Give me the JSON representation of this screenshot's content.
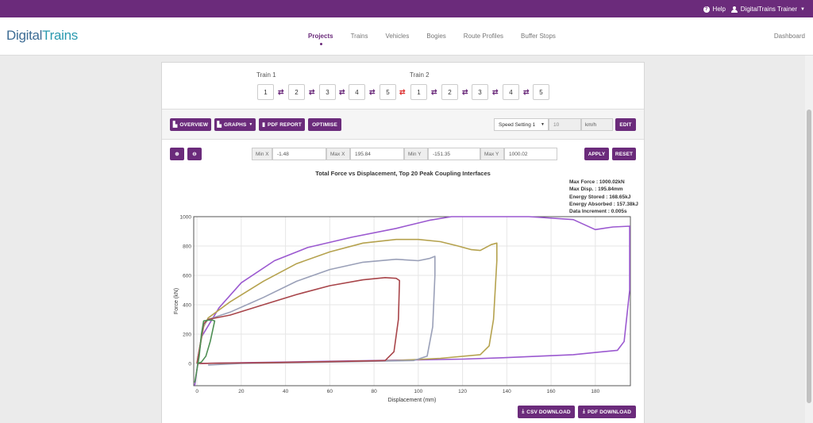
{
  "topbar": {
    "help": "Help",
    "user": "DigitalTrains Trainer"
  },
  "logo": {
    "part1": "Digital",
    "part2": "Trains"
  },
  "nav": {
    "items": [
      "Projects",
      "Trains",
      "Vehicles",
      "Bogies",
      "Route Profiles",
      "Buffer Stops"
    ],
    "active": "Projects",
    "dashboard": "Dashboard"
  },
  "trains": {
    "train1_label": "Train 1",
    "train2_label": "Train 2",
    "train1": [
      "1",
      "2",
      "3",
      "4",
      "5"
    ],
    "train2": [
      "1",
      "2",
      "3",
      "4",
      "5"
    ],
    "coupling_icon": "swap-arrows-icon"
  },
  "toolbar": {
    "overview": "OVERVIEW",
    "graphs": "GRAPHS",
    "pdf_report": "PDF REPORT",
    "optimise": "OPTIMISE",
    "speed_setting": "Speed Setting 1",
    "speed_value": "10",
    "speed_unit": "km/h",
    "edit": "EDIT"
  },
  "limits": {
    "min_x_label": "Min X",
    "min_x": "-1.48",
    "max_x_label": "Max X",
    "max_x": "195.84",
    "min_y_label": "Min Y",
    "min_y": "-151.35",
    "max_y_label": "Max Y",
    "max_y": "1000.02",
    "apply": "APPLY",
    "reset": "RESET"
  },
  "stats": {
    "max_force": "Max Force : 1000.02kN",
    "max_disp": "Max Disp. : 195.84mm",
    "energy_stored": "Energy Stored : 168.65kJ",
    "energy_absorbed": "Energy Absorbed : 157.38kJ",
    "data_increment": "Data Increment : 0.005s"
  },
  "downloads": {
    "csv": "CSV DOWNLOAD",
    "pdf": "PDF DOWNLOAD"
  },
  "colors": {
    "accent": "#6b2b7b"
  },
  "chart_data": {
    "type": "line",
    "title": "Total Force vs Displacement, Top 20 Peak Coupling Interfaces",
    "xlabel": "Displacement (mm)",
    "ylabel": "Force (kN)",
    "xlim": [
      -1.48,
      195.84
    ],
    "ylim": [
      -151.35,
      1000.02
    ],
    "xticks": [
      0,
      20,
      40,
      60,
      80,
      100,
      120,
      140,
      160,
      180
    ],
    "yticks": [
      0,
      200,
      400,
      600,
      800,
      1000
    ],
    "grid": true,
    "series": [
      {
        "color": "#9b59d0",
        "points": [
          [
            -1,
            -150
          ],
          [
            2,
            180
          ],
          [
            10,
            380
          ],
          [
            20,
            550
          ],
          [
            35,
            700
          ],
          [
            50,
            790
          ],
          [
            70,
            860
          ],
          [
            90,
            920
          ],
          [
            105,
            975
          ],
          [
            115,
            1000
          ],
          [
            150,
            1000
          ],
          [
            170,
            980
          ],
          [
            180,
            912
          ],
          [
            188,
            930
          ],
          [
            195.5,
            935
          ],
          [
            195.5,
            500
          ],
          [
            193,
            150
          ],
          [
            190,
            90
          ],
          [
            170,
            60
          ],
          [
            140,
            40
          ],
          [
            120,
            30
          ],
          [
            100,
            25
          ],
          [
            80,
            20
          ],
          [
            60,
            15
          ],
          [
            40,
            10
          ],
          [
            20,
            5
          ],
          [
            0,
            0
          ]
        ]
      },
      {
        "color": "#b5a24e",
        "points": [
          [
            0,
            0
          ],
          [
            3,
            250
          ],
          [
            5,
            310
          ],
          [
            15,
            420
          ],
          [
            30,
            560
          ],
          [
            45,
            680
          ],
          [
            60,
            760
          ],
          [
            75,
            820
          ],
          [
            90,
            845
          ],
          [
            100,
            845
          ],
          [
            110,
            830
          ],
          [
            118,
            800
          ],
          [
            124,
            775
          ],
          [
            128,
            770
          ],
          [
            133,
            810
          ],
          [
            135.5,
            820
          ],
          [
            135.5,
            700
          ],
          [
            134,
            300
          ],
          [
            132,
            120
          ],
          [
            128,
            60
          ],
          [
            110,
            35
          ],
          [
            90,
            20
          ],
          [
            70,
            15
          ],
          [
            50,
            10
          ],
          [
            30,
            5
          ],
          [
            10,
            0
          ]
        ]
      },
      {
        "color": "#9aa0b8",
        "points": [
          [
            0,
            0
          ],
          [
            3,
            260
          ],
          [
            5,
            300
          ],
          [
            15,
            350
          ],
          [
            30,
            450
          ],
          [
            45,
            560
          ],
          [
            60,
            640
          ],
          [
            75,
            690
          ],
          [
            90,
            710
          ],
          [
            100,
            700
          ],
          [
            105,
            715
          ],
          [
            107.5,
            730
          ],
          [
            107.5,
            600
          ],
          [
            106.5,
            250
          ],
          [
            104,
            50
          ],
          [
            98,
            20
          ],
          [
            80,
            15
          ],
          [
            60,
            10
          ],
          [
            40,
            5
          ],
          [
            20,
            0
          ],
          [
            5,
            -10
          ]
        ]
      },
      {
        "color": "#a8454a",
        "points": [
          [
            0,
            0
          ],
          [
            3,
            270
          ],
          [
            5,
            300
          ],
          [
            15,
            330
          ],
          [
            30,
            400
          ],
          [
            45,
            470
          ],
          [
            60,
            530
          ],
          [
            75,
            570
          ],
          [
            85,
            585
          ],
          [
            90,
            580
          ],
          [
            91.5,
            565
          ],
          [
            91,
            300
          ],
          [
            89,
            80
          ],
          [
            85,
            20
          ],
          [
            70,
            15
          ],
          [
            50,
            10
          ],
          [
            30,
            5
          ],
          [
            10,
            2
          ],
          [
            0,
            0
          ]
        ]
      },
      {
        "color": "#4e8f54",
        "points": [
          [
            -1,
            -130
          ],
          [
            1,
            50
          ],
          [
            2,
            200
          ],
          [
            3,
            290
          ],
          [
            5,
            295
          ],
          [
            7,
            295
          ],
          [
            8,
            290
          ],
          [
            6,
            150
          ],
          [
            4,
            50
          ],
          [
            2,
            10
          ],
          [
            0,
            0
          ]
        ]
      }
    ]
  }
}
